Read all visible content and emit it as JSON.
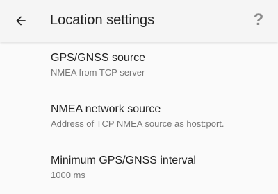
{
  "toolbar": {
    "back_icon": "arrow-left-icon",
    "title": "Location settings",
    "help_icon": "?"
  },
  "settings": [
    {
      "title": "GPS/GNSS source",
      "summary": "NMEA from TCP server"
    },
    {
      "title": "NMEA network source",
      "summary": "Address of TCP NMEA source as host:port."
    },
    {
      "title": "Minimum GPS/GNSS interval",
      "summary": "1000 ms"
    }
  ],
  "colors": {
    "background": "#fafafa",
    "toolbar": "#f5f5f5",
    "primary_text": "#212121",
    "secondary_text": "#757575",
    "icon": "#8a8a8a"
  }
}
